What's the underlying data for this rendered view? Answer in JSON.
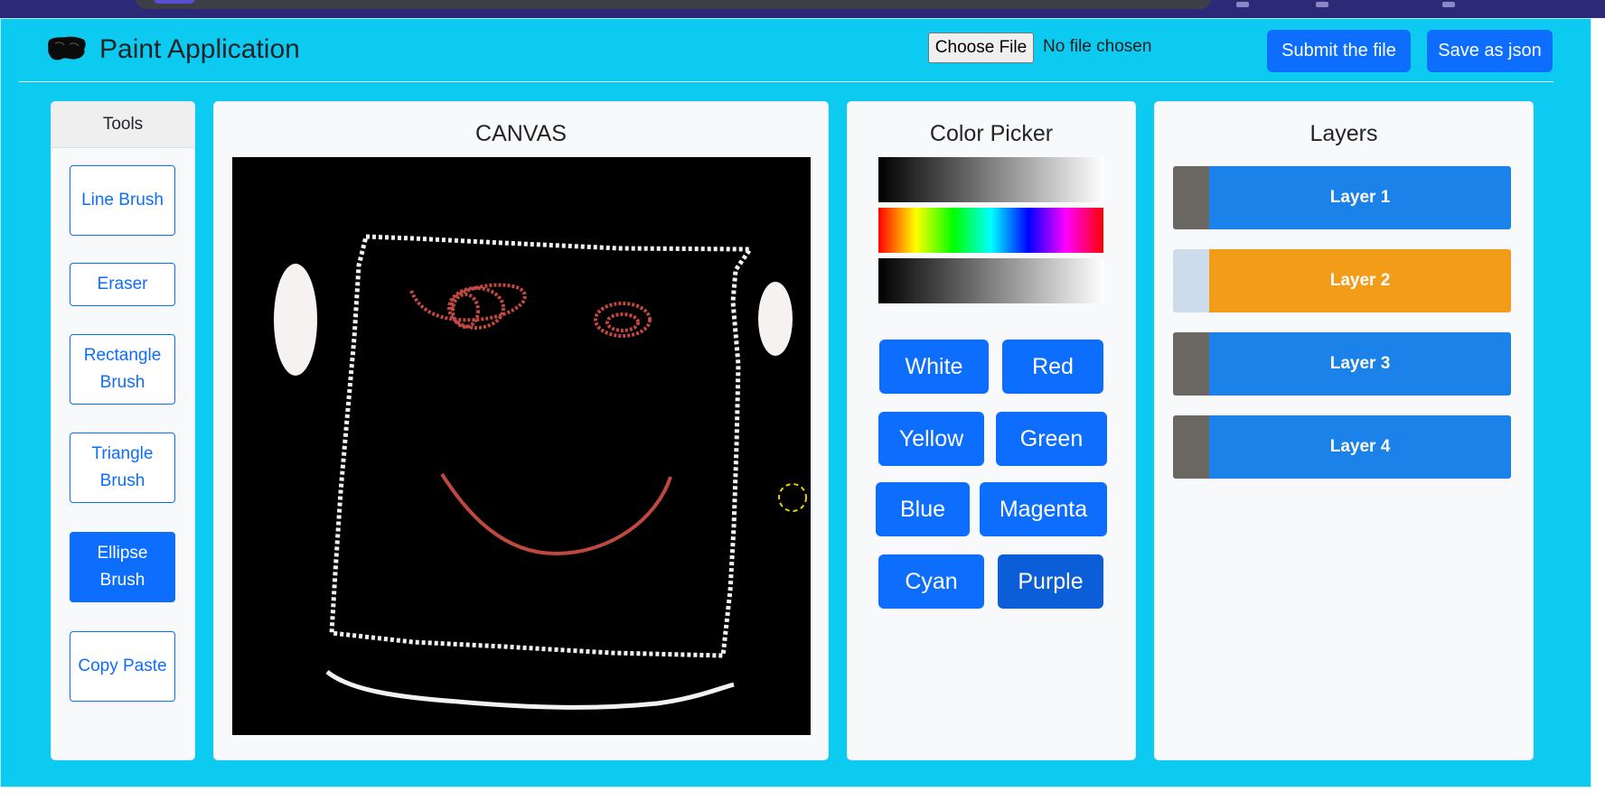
{
  "app": {
    "title": "Paint Application",
    "logo_icon": "paint-blob-icon"
  },
  "header": {
    "choose_file_label": "Choose File",
    "file_status": "No file chosen",
    "submit_label": "Submit the file",
    "save_json_label": "Save as json"
  },
  "tools": {
    "heading": "Tools",
    "items": [
      {
        "label": "Line Brush",
        "active": false
      },
      {
        "label": "Eraser",
        "active": false
      },
      {
        "label": "Rectangle Brush",
        "active": false
      },
      {
        "label": "Triangle Brush",
        "active": false
      },
      {
        "label": "Ellipse Brush",
        "active": true
      },
      {
        "label": "Copy Paste",
        "active": false
      }
    ]
  },
  "canvas": {
    "heading": "CANVAS",
    "background": "#000000",
    "stroke_colors": {
      "white": "#ffffff",
      "red": "#c0493f",
      "cursor": "#e3d400"
    }
  },
  "color_picker": {
    "heading": "Color Picker",
    "buttons": [
      "White",
      "Red",
      "Yellow",
      "Green",
      "Blue",
      "Magenta",
      "Cyan",
      "Purple"
    ]
  },
  "layers": {
    "heading": "Layers",
    "items": [
      {
        "label": "Layer 1",
        "swatch": "#6b6863",
        "color": "#1a82e8"
      },
      {
        "label": "Layer 2",
        "swatch": "#cddcea",
        "color": "#f39c1a"
      },
      {
        "label": "Layer 3",
        "swatch": "#6b6863",
        "color": "#1a82e8"
      },
      {
        "label": "Layer 4",
        "swatch": "#6b6863",
        "color": "#1a82e8"
      }
    ]
  },
  "theme": {
    "page_bg": "#0dcaf0",
    "primary": "#0d6efd"
  }
}
